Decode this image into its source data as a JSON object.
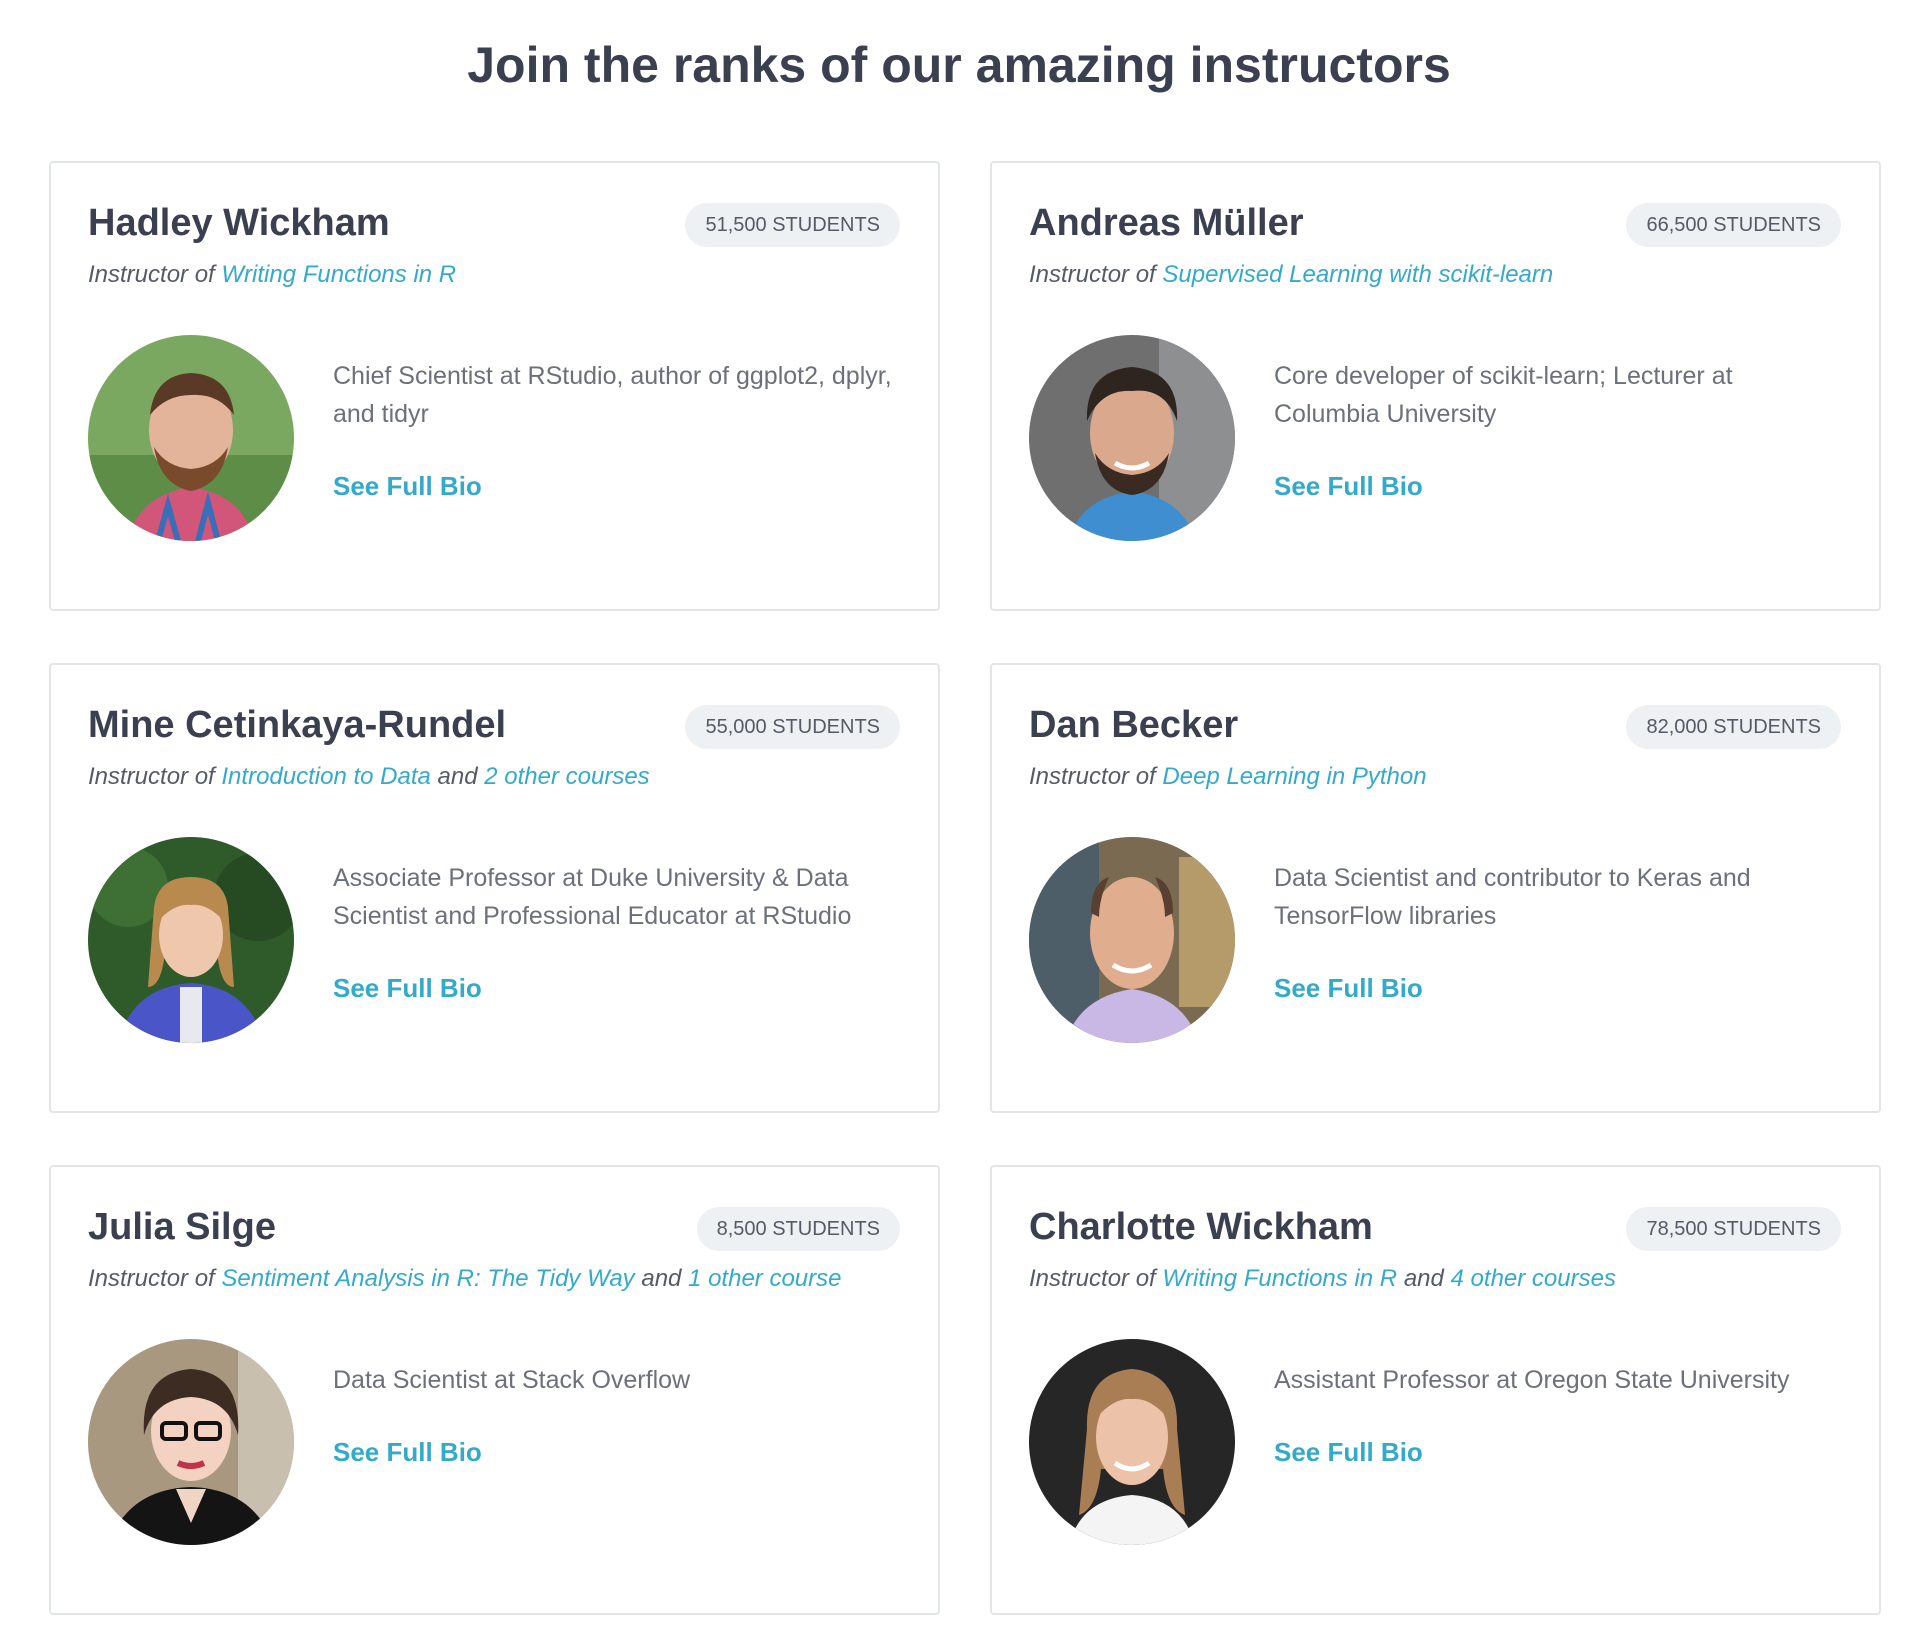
{
  "page": {
    "title": "Join the ranks of our amazing instructors"
  },
  "colors": {
    "accent": "#33aacc",
    "heading": "#3b4050",
    "badge_bg": "#eef1f3",
    "card_border": "#e3e6e9",
    "body_text": "#6b707a"
  },
  "instructors": [
    {
      "name": "Hadley Wickham",
      "students": "51,500 STUDENTS",
      "prefix": "Instructor of",
      "course": "Writing Functions in R",
      "connector": "",
      "other": "",
      "bio": "Chief Scientist at RStudio, author of ggplot2, dplyr, and tidyr",
      "bio_link": "See Full Bio",
      "avatar_icon": "person-photo"
    },
    {
      "name": "Andreas Müller",
      "students": "66,500 STUDENTS",
      "prefix": "Instructor of",
      "course": "Supervised Learning with scikit-learn",
      "connector": "",
      "other": "",
      "bio": "Core developer of scikit-learn; Lecturer at Columbia University",
      "bio_link": "See Full Bio",
      "avatar_icon": "person-photo"
    },
    {
      "name": "Mine Cetinkaya-Rundel",
      "students": "55,000 STUDENTS",
      "prefix": "Instructor of",
      "course": "Introduction to Data",
      "connector": "and",
      "other": "2 other courses",
      "bio": "Associate Professor at Duke University & Data Scientist and Professional Educator at RStudio",
      "bio_link": "See Full Bio",
      "avatar_icon": "person-photo"
    },
    {
      "name": "Dan Becker",
      "students": "82,000 STUDENTS",
      "prefix": "Instructor of",
      "course": "Deep Learning in Python",
      "connector": "",
      "other": "",
      "bio": "Data Scientist and contributor to Keras and TensorFlow libraries",
      "bio_link": "See Full Bio",
      "avatar_icon": "person-photo"
    },
    {
      "name": "Julia Silge",
      "students": "8,500 STUDENTS",
      "prefix": "Instructor of",
      "course": "Sentiment Analysis in R: The Tidy Way",
      "connector": "and",
      "other": "1 other course",
      "bio": "Data Scientist at Stack Overflow",
      "bio_link": "See Full Bio",
      "avatar_icon": "person-photo"
    },
    {
      "name": "Charlotte Wickham",
      "students": "78,500 STUDENTS",
      "prefix": "Instructor of",
      "course": "Writing Functions in R",
      "connector": "and",
      "other": "4 other courses",
      "bio": "Assistant Professor at Oregon State University",
      "bio_link": "See Full Bio",
      "avatar_icon": "person-photo"
    }
  ]
}
